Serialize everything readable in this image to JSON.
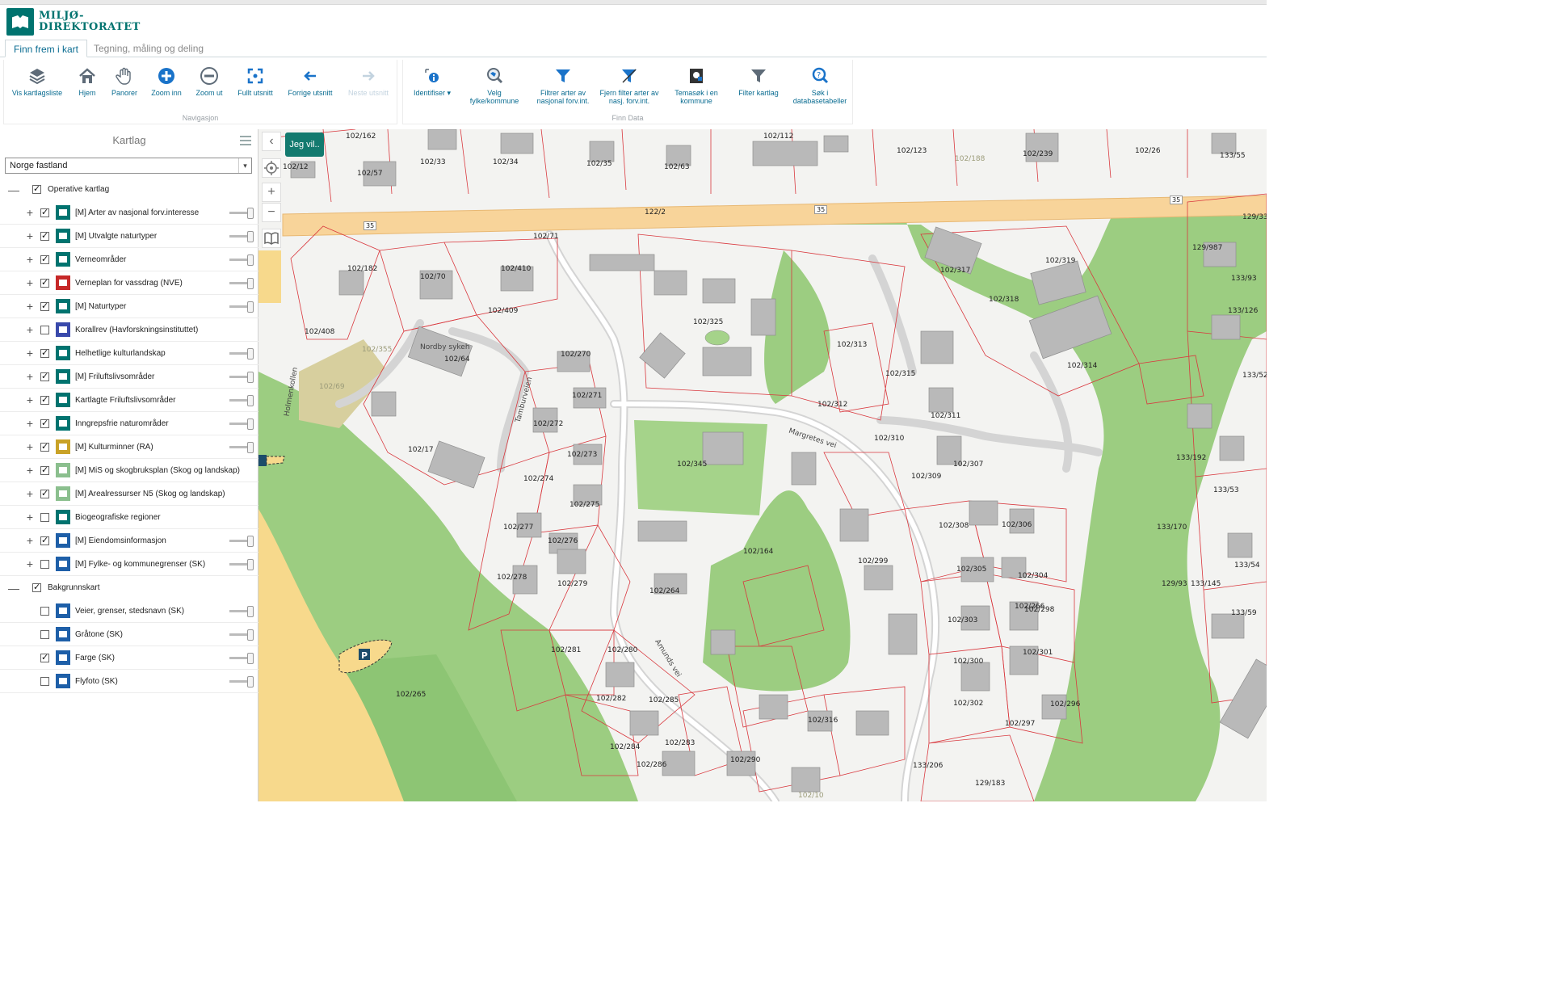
{
  "brand": {
    "line1": "MILJØ-",
    "line2": "DIREKTORATET"
  },
  "tabs": [
    {
      "label": "Finn frem i kart"
    },
    {
      "label": "Tegning, måling og deling"
    }
  ],
  "navigasjon": {
    "label": "Navigasjon",
    "buttons": [
      {
        "label": "Vis kartlagsliste",
        "icon": "layers-icon"
      },
      {
        "label": "Hjem",
        "icon": "home-icon"
      },
      {
        "label": "Panorer",
        "icon": "hand-icon"
      },
      {
        "label": "Zoom inn",
        "icon": "zoom-in-icon"
      },
      {
        "label": "Zoom ut",
        "icon": "zoom-out-icon"
      },
      {
        "label": "Fullt utsnitt",
        "icon": "full-extent-icon"
      },
      {
        "label": "Forrige utsnitt",
        "icon": "back-icon"
      },
      {
        "label": "Neste utsnitt",
        "icon": "forward-icon"
      }
    ]
  },
  "finn_data": {
    "label": "Finn Data",
    "buttons": [
      {
        "label": "Identifiser",
        "icon": "identify-icon"
      },
      {
        "label": "Velg fylke/kommune",
        "icon": "select-region-icon"
      },
      {
        "label": "Filtrer arter av nasjonal forv.int.",
        "icon": "filter-icon"
      },
      {
        "label": "Fjern filter arter av nasj. forv.int.",
        "icon": "remove-filter-icon"
      },
      {
        "label": "Temasøk i en kommune",
        "icon": "theme-search-icon"
      },
      {
        "label": "Filter kartlag",
        "icon": "filter-layers-icon"
      },
      {
        "label": "Søk i databasetabeller",
        "icon": "search-db-icon"
      }
    ]
  },
  "panel": {
    "title": "Kartlag",
    "region": "Norge fastland",
    "operative": {
      "label": "Operative kartlag",
      "layers": [
        {
          "name": "[M] Arter av nasjonal forv.interesse",
          "checked": true
        },
        {
          "name": "[M] Utvalgte naturtyper",
          "checked": true
        },
        {
          "name": "Verneområder",
          "checked": true
        },
        {
          "name": "Verneplan for vassdrag (NVE)",
          "checked": true
        },
        {
          "name": "[M] Naturtyper",
          "checked": true
        },
        {
          "name": "Korallrev (Havforskningsinstituttet)",
          "checked": false
        },
        {
          "name": "Helhetlige kulturlandskap",
          "checked": true
        },
        {
          "name": "[M] Friluftslivsområder",
          "checked": true
        },
        {
          "name": "Kartlagte Friluftslivsområder",
          "checked": true
        },
        {
          "name": "Inngrepsfrie naturområder",
          "checked": true
        },
        {
          "name": "[M] Kulturminner (RA)",
          "checked": true
        },
        {
          "name": "[M] MiS og skogbruksplan (Skog og landskap)",
          "checked": true
        },
        {
          "name": "[M] Arealressurser N5 (Skog og landskap)",
          "checked": true
        },
        {
          "name": "Biogeografiske regioner",
          "checked": false
        },
        {
          "name": "[M] Eiendomsinformasjon",
          "checked": true
        },
        {
          "name": "[M] Fylke- og kommunegrenser (SK)",
          "checked": false
        }
      ]
    },
    "background": {
      "label": "Bakgrunnskart",
      "layers": [
        {
          "name": "Veier, grenser, stedsnavn (SK)",
          "checked": false
        },
        {
          "name": "Gråtone (SK)",
          "checked": false
        },
        {
          "name": "Farge (SK)",
          "checked": true
        },
        {
          "name": "Flyfoto (SK)",
          "checked": false
        }
      ]
    }
  },
  "map": {
    "jeg_vil": "Jeg vil..",
    "streets": [
      "Margretes vei",
      "Tamburveien",
      "Amunds vei",
      "Holmenkollen",
      "Nordby sykeh"
    ],
    "parcels": [
      "102/162",
      "102/12",
      "102/57",
      "102/33",
      "102/34",
      "102/35",
      "102/63",
      "102/112",
      "102/123",
      "102/188",
      "102/239",
      "102/26",
      "133/55",
      "122/2",
      "102/71",
      "102/182",
      "102/70",
      "102/410",
      "102/408",
      "102/409",
      "102/355",
      "102/64",
      "102/69",
      "102/325",
      "102/270",
      "102/271",
      "102/272",
      "102/17",
      "102/274",
      "102/273",
      "102/275",
      "102/277",
      "102/276",
      "102/345",
      "102/278",
      "102/279",
      "102/264",
      "102/164",
      "102/281",
      "102/280",
      "102/282",
      "102/285",
      "102/283",
      "102/284",
      "102/286",
      "102/290",
      "102/10",
      "102/265",
      "102/316",
      "102/317",
      "102/319",
      "102/318",
      "102/314",
      "102/313",
      "102/315",
      "102/312",
      "102/311",
      "102/310",
      "102/309",
      "102/307",
      "102/308",
      "102/306",
      "102/305",
      "102/304",
      "102/266",
      "102/298",
      "102/299",
      "102/303",
      "102/300",
      "102/301",
      "102/302",
      "102/297",
      "102/296",
      "133/206",
      "129/183",
      "129/33",
      "129/987",
      "133/93",
      "133/126",
      "133/52",
      "133/192",
      "133/53",
      "133/170",
      "129/93",
      "133/145",
      "133/54",
      "133/59"
    ],
    "road_numbers": [
      "35",
      "35",
      "35"
    ]
  },
  "colors": {
    "brand": "#00736f",
    "link": "#0a6c91",
    "forest": "#9ccd81",
    "forest_dark": "#83bf6b",
    "farmland": "#f7d98c",
    "road_main": "#f8d49a",
    "parcel_line": "#d9383e"
  }
}
